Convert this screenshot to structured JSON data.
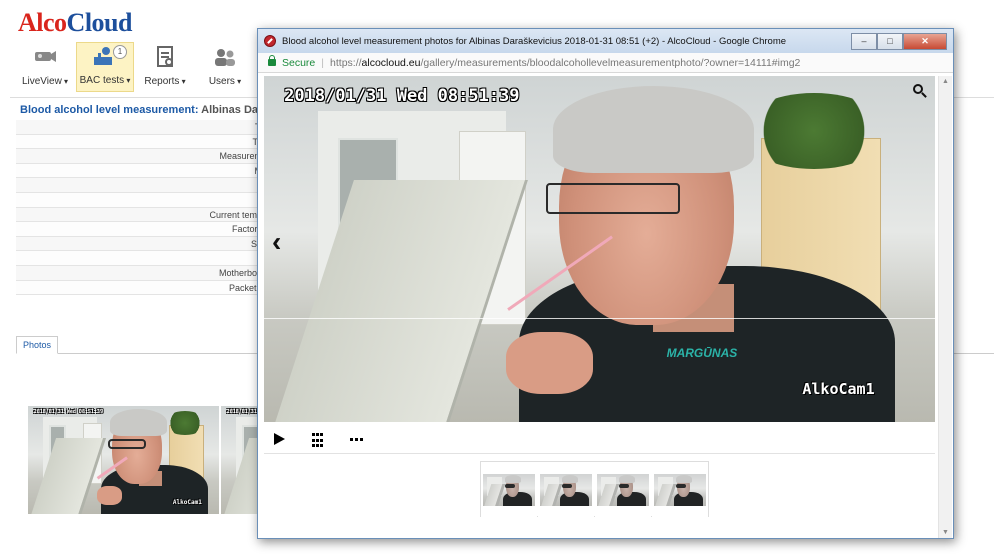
{
  "app": {
    "logo_part1": "Alco",
    "logo_part2": "Cloud",
    "nav": [
      {
        "label": "LiveView",
        "icon": "camera-icon"
      },
      {
        "label": "BAC tests",
        "icon": "bac-test-icon",
        "badge": "1"
      },
      {
        "label": "Reports",
        "icon": "report-icon"
      },
      {
        "label": "Users",
        "icon": "users-icon"
      }
    ],
    "page_title_prefix": "Blood alcohol level measurement:",
    "page_title_name": "Albinas Dara",
    "info_rows": [
      "Ti",
      "Te",
      "Measurem",
      "M",
      "",
      "",
      "Current temp",
      "Factory",
      "Se",
      "",
      "Motherboa",
      "Packet r"
    ],
    "photos_tab": "Photos",
    "thumb_stamp": "2018/01/31 Wed 08:51:39",
    "thumb_cam": "AlkoCam1"
  },
  "window": {
    "title": "Blood alcohol level measurement photos for Albinas Daraškevicius 2018-01-31 08:51 (+2) - AlcoCloud - Google Chrome",
    "buttons": {
      "minimize": "–",
      "maximize": "□",
      "close": "✕"
    },
    "address": {
      "secure_label": "Secure",
      "separator": "|",
      "url_scheme": "https://",
      "url_host": "alcocloud.eu",
      "url_path": "/gallery/measurements/bloodalcohollevelmeasurementphoto/?owner=14111#img2"
    }
  },
  "viewer": {
    "timestamp": "2018/01/31 Wed 08:51:39",
    "camera_label": "AlkoCam1",
    "jacket_logo": "MARGŪNAS",
    "prev_arrow": "‹"
  },
  "thumbnails_count": 4
}
